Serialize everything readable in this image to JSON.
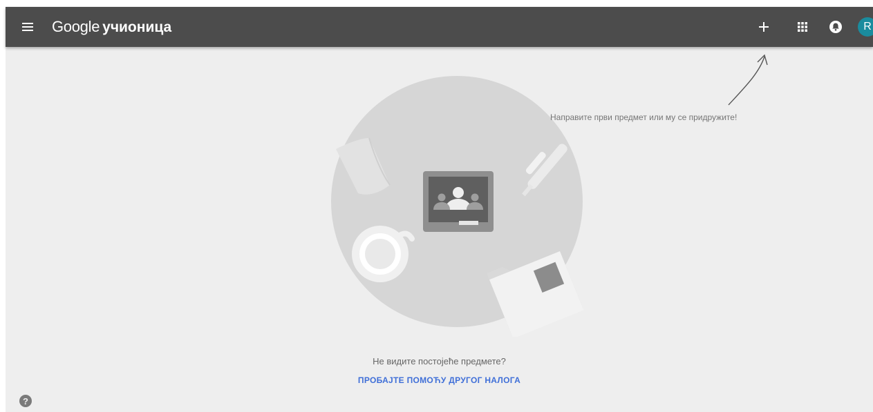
{
  "header": {
    "brand": "Google",
    "product": "учионица",
    "create_join_label": "+",
    "avatar_initial": "R",
    "avatar_color": "#1a8c9e"
  },
  "icons": {
    "menu": "hamburger-menu-icon",
    "apps": "apps-grid-icon",
    "notifications": "notifications-icon",
    "help": "help-icon"
  },
  "main": {
    "hint": "Направите први предмет или му се придружите!",
    "no_classes_question": "Не видите постојеће предмете?",
    "switch_account_link": "ПРОБАЈТЕ ПОМОЋУ ДРУГОГ НАЛОГА",
    "help_glyph": "?"
  },
  "colors": {
    "topbar": "#4c4c4c",
    "background": "#eeeeee",
    "link": "#3f6fd8"
  }
}
